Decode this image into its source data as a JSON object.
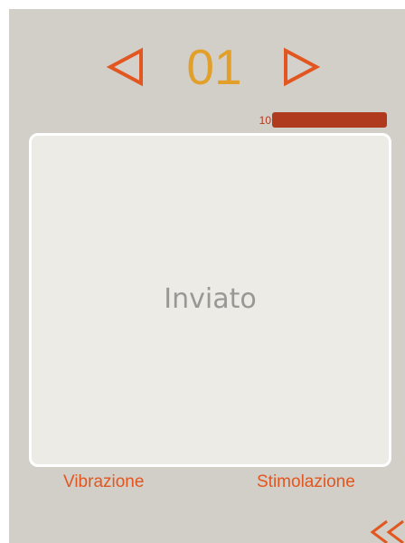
{
  "nav": {
    "channel_number": "01",
    "prev_icon": "triangle-left-icon",
    "next_icon": "triangle-right-icon"
  },
  "level": {
    "value": "10",
    "fill_fraction": 1.0
  },
  "panel": {
    "status_text": "Inviato"
  },
  "modes": {
    "left_label": "Vibrazione",
    "right_label": "Stimolazione"
  },
  "back": {
    "icon": "double-chevron-left-icon"
  },
  "colors": {
    "background": "#d2cec8",
    "panel": "#edebe5",
    "accent_orange": "#e2561f",
    "number_gold": "#e2a02a",
    "level_bar": "#b03a1e",
    "status_grey": "#9a9894"
  }
}
